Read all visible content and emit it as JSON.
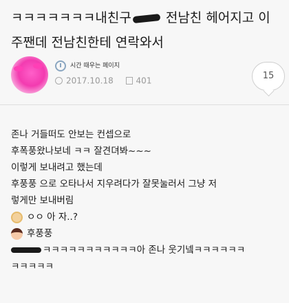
{
  "post": {
    "title_pre": "ㅋㅋㅋㅋㅋㅋㅋ내친구",
    "title_post": " 전남친 헤어지고 이주짼데 전남친한테 연락와서"
  },
  "meta": {
    "board_name": "시간 때우는 페이지",
    "date": "2017.10.18",
    "views": "401",
    "comment_count": "15"
  },
  "content": {
    "lines": [
      "존나 거들떠도 안보는 컨셉으로",
      "후폭풍왔나보네 ㅋㅋ 잘견뎌봐~~~",
      "이렇게 보내려고 했는데",
      "후풍풍 으로 오타나서 지우려다가 잘못눌러서 그냥 저",
      "렇게만 보내버림"
    ],
    "chat1": "ㅇㅇ 아 자..?",
    "chat2": "후풍풍",
    "last_line_a": "ㅋㅋㅋㅋㅋㅋㅋㅋㅋㅋㅋ아 존나 웃기넼ㅋㅋㅋㅋㅋㅋ",
    "last_line_b": "ㅋㅋㅋㅋㅋ"
  },
  "icons": {
    "avatar": "pink-character-avatar",
    "board": "clock-icon",
    "date": "clock-icon",
    "views": "document-icon"
  }
}
